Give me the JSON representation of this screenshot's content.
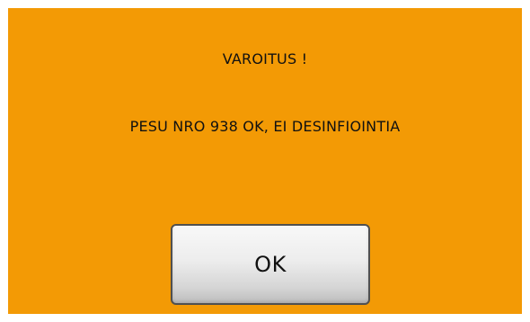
{
  "dialog": {
    "title": "VAROITUS !",
    "message": "PESU NRO 938 OK, EI DESINFIOINTIA",
    "ok_label": "OK"
  },
  "colors": {
    "background": "#f39a05",
    "text": "#111111",
    "button_face": "#ededed",
    "button_border": "#505050"
  }
}
